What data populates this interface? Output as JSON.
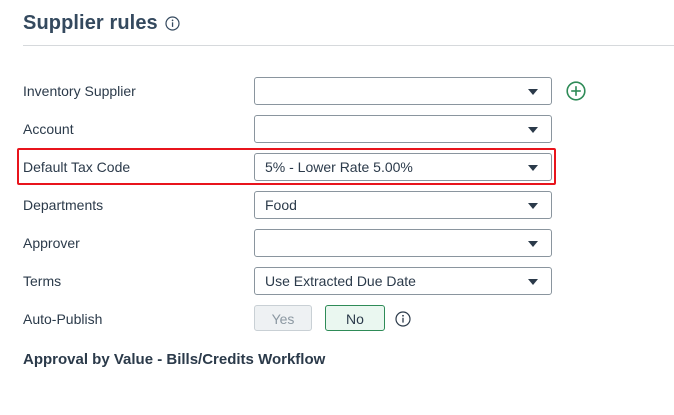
{
  "header": {
    "title": "Supplier rules"
  },
  "form": {
    "rows": [
      {
        "label": "Inventory Supplier",
        "value": ""
      },
      {
        "label": "Account",
        "value": ""
      },
      {
        "label": "Default Tax Code",
        "value": "5% - Lower Rate 5.00%"
      },
      {
        "label": "Departments",
        "value": "Food"
      },
      {
        "label": "Approver",
        "value": ""
      },
      {
        "label": "Terms",
        "value": "Use Extracted Due Date"
      }
    ],
    "auto_publish": {
      "label": "Auto-Publish",
      "yes_label": "Yes",
      "no_label": "No",
      "selected": "No"
    }
  },
  "section": {
    "heading": "Approval by Value - Bills/Credits Workflow"
  },
  "colors": {
    "highlight": "#e8141c",
    "accent_green": "#2e8b57",
    "text": "#2b3a4a"
  },
  "icons": {
    "title_info": "info-icon",
    "add": "plus-circle-icon",
    "auto_publish_info": "info-icon",
    "dropdown": "chevron-down-icon"
  }
}
